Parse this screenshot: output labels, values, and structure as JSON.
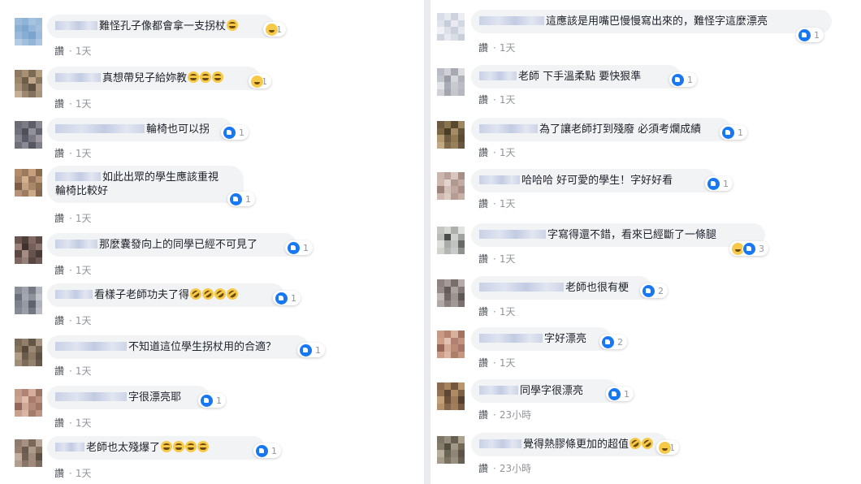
{
  "like_label": "讚",
  "left": [
    {
      "avatar": [
        "#9bbbd9",
        "#8fb3d6",
        "#a6c3de",
        "#9dbad8",
        "#8cb0d4",
        "#7fa6cf",
        "#94b6da",
        "#a3c1de",
        "#9ab8d9",
        "#88add3",
        "#7aa3cd",
        "#9cbadb",
        "#b3cce4",
        "#a2bfdd",
        "#93b5d8",
        "#aac6e1"
      ],
      "text": "難怪孔子像都會拿一支拐杖",
      "emoji": [
        "haha"
      ],
      "reacts": [
        "haha"
      ],
      "count": "1",
      "time": "1天"
    },
    {
      "avatar": [
        "#8d7a62",
        "#a89074",
        "#7b6a55",
        "#b49c7e",
        "#9a876c",
        "#6e5d49",
        "#c0a586",
        "#8a7760",
        "#a6927a",
        "#7f6d59",
        "#5f5142",
        "#b09980",
        "#c4b098",
        "#9c8870",
        "#847260",
        "#a8957d"
      ],
      "text": "真想帶兒子給妳教",
      "emoji": [
        "haha",
        "haha",
        "haha"
      ],
      "reacts": [
        "haha"
      ],
      "count": "1",
      "time": "1天"
    },
    {
      "avatar": [
        "#6b6c76",
        "#7d7a82",
        "#5c5e68",
        "#8a8790",
        "#70717b",
        "#4d4f5a",
        "#929099",
        "#63646e",
        "#85838c",
        "#5a5b66",
        "#787982",
        "#9c99a2",
        "#6f707a",
        "#8b8993",
        "#55565f",
        "#7e7f88"
      ],
      "text": "輪椅也可以拐",
      "emoji": [],
      "reacts": [
        "like"
      ],
      "count": "1",
      "time": "1天"
    },
    {
      "avatar": [
        "#b08c6a",
        "#9c7a5c",
        "#c6a07c",
        "#8a6b50",
        "#a58265",
        "#d4b08e",
        "#94735a",
        "#b99676",
        "#7c5e46",
        "#c3a182",
        "#a88768",
        "#8f7055",
        "#b5927a",
        "#9e7c62",
        "#caa888",
        "#86684f"
      ],
      "text": "如此出眾的學生應該重視\n輪椅比較好",
      "emoji": [],
      "reacts": [
        "like"
      ],
      "count": "1",
      "time": "1天"
    },
    {
      "avatar": [
        "#6a5550",
        "#4f3f3b",
        "#826a63",
        "#5c4a45",
        "#9a827a",
        "#3e312e",
        "#745e58",
        "#8c756e",
        "#5a4843",
        "#a48c83",
        "#665350",
        "#4a3b37",
        "#7e6760",
        "#94807a",
        "#574641",
        "#6f5a55"
      ],
      "text": "那麼囊發向上的同學已經不可見了",
      "emoji": [],
      "reacts": [
        "like"
      ],
      "count": "1",
      "time": "1天"
    },
    {
      "avatar": [
        "#8a8e98",
        "#9ea2ac",
        "#767a84",
        "#b2b5bd",
        "#6c707a",
        "#a3a7b0",
        "#8e929c",
        "#c0c3ca",
        "#7d818b",
        "#959aa3",
        "#5f636d",
        "#aeb1b9",
        "#868a94",
        "#9a9ea8",
        "#737781",
        "#b8bbc2"
      ],
      "text": "看樣子老師功夫了得",
      "emoji": [
        "rofl",
        "rofl",
        "rofl",
        "rofl"
      ],
      "reacts": [
        "like"
      ],
      "count": "1",
      "time": "1天"
    },
    {
      "avatar": [
        "#7a6a5a",
        "#917f6c",
        "#645647",
        "#a69380",
        "#85745f",
        "#57493b",
        "#9b8874",
        "#726251",
        "#b09d89",
        "#6a5b4b",
        "#8c7a66",
        "#5f5142",
        "#a18e7a",
        "#7d6c59",
        "#94826e",
        "#685949"
      ],
      "text": "不知道這位學生拐杖用的合適？",
      "emoji": [],
      "reacts": [
        "like"
      ],
      "count": "1",
      "time": "1天"
    },
    {
      "avatar": [
        "#c49a8a",
        "#b08474",
        "#d6ad9c",
        "#9e7464",
        "#c8a090",
        "#e0bcac",
        "#a87c6c",
        "#bb9181",
        "#92685a",
        "#d0a898",
        "#b48a7a",
        "#a07666",
        "#c9a191",
        "#dab4a4",
        "#a57b6b",
        "#be9585"
      ],
      "text": "字很漂亮耶",
      "emoji": [],
      "reacts": [
        "like"
      ],
      "count": "1",
      "time": "1天"
    },
    {
      "avatar": [
        "#8f7c6e",
        "#a69284",
        "#7a685b",
        "#b8a596",
        "#958273",
        "#6b5a4e",
        "#ad9a8b",
        "#84725f",
        "#c1ae9f",
        "#726152",
        "#9f8c7d",
        "#5e4f44",
        "#b19e8f",
        "#887667",
        "#a0897a",
        "#7d6b5d"
      ],
      "text": "老師也太殘爆了",
      "emoji": [
        "haha",
        "haha",
        "haha",
        "haha"
      ],
      "reacts": [
        "like"
      ],
      "count": "1",
      "time": "1天"
    }
  ],
  "right": [
    {
      "avatar": [
        "#d8dce6",
        "#e6e9ef",
        "#cdd2dd",
        "#eceef3",
        "#dfe2ea",
        "#c6ccd8",
        "#e9ebf1",
        "#d4d8e2",
        "#f0f1f5",
        "#dde0e8",
        "#cbd0db",
        "#e4e7ed",
        "#d1d5df",
        "#e8eaf0",
        "#d9dde6",
        "#c9cfda"
      ],
      "text": "這應該是用嘴巴慢慢寫出來的，難怪字這麼漂亮",
      "emoji": [],
      "reacts": [
        "like"
      ],
      "count": "1",
      "time": "1天"
    },
    {
      "avatar": [
        "#b9bcc3",
        "#cfd1d6",
        "#a6a9b1",
        "#dcdde1",
        "#c2c5cb",
        "#9a9da6",
        "#d5d7db",
        "#b0b3ba",
        "#e3e4e7",
        "#a9acb4",
        "#c8cad0",
        "#bbbdc4",
        "#d0d2d7",
        "#a3a6ae",
        "#c5c7cd",
        "#b5b8bf"
      ],
      "text": "老師 下手溫柔點 要快狠準",
      "emoji": [],
      "reacts": [
        "like"
      ],
      "count": "1",
      "time": "1天"
    },
    {
      "avatar": [
        "#6b5a3e",
        "#8a744f",
        "#57492f",
        "#9e8660",
        "#7a6646",
        "#4a3d26",
        "#a58c66",
        "#645238",
        "#b39a72",
        "#6e5c40",
        "#8f7852",
        "#5a4a31",
        "#c2a985",
        "#7f6a49",
        "#98805a",
        "#685640"
      ],
      "text": "為了讓老師打到殘廢 必須考爛成績",
      "emoji": [],
      "reacts": [
        "like"
      ],
      "count": "1",
      "time": "1天"
    },
    {
      "avatar": [
        "#c9b6ad",
        "#b8a198",
        "#d8c7bf",
        "#a88e85",
        "#cdb9b0",
        "#e2d4cd",
        "#b19990",
        "#c2aca3",
        "#9c8279",
        "#d3c1b9",
        "#bfa9a0",
        "#a98f86",
        "#ccb8af",
        "#dccbc4",
        "#b59d94",
        "#c6b0a7"
      ],
      "text": "哈哈哈 好可愛的學生！字好好看",
      "emoji": [],
      "reacts": [
        "like"
      ],
      "count": "1",
      "time": "1天"
    },
    {
      "avatar": [
        "#c3c6c2",
        "#d6d8d4",
        "#adb0ac",
        "#e2e3e0",
        "#b9bcb8",
        "#4b4d4a",
        "#cdd0cc",
        "#9fa29e",
        "#dcdedb",
        "#a8aba7",
        "#c0c3bf",
        "#676966",
        "#d1d3cf",
        "#b3b6b2",
        "#c7cac6",
        "#8e918d"
      ],
      "text": "字寫得還不錯，看來已經斷了一條腿",
      "emoji": [],
      "reacts": [
        "haha",
        "like"
      ],
      "count": "3",
      "time": "1天"
    },
    {
      "avatar": [
        "#8e8380",
        "#a59a97",
        "#786e6b",
        "#b5acaa",
        "#968b88",
        "#655c5a",
        "#aca3a1",
        "#837976",
        "#c0b8b6",
        "#716866",
        "#9d9390",
        "#5f5755",
        "#b1a8a6",
        "#8a807d",
        "#a29896",
        "#7a716e"
      ],
      "text": "老師也很有梗",
      "emoji": [],
      "reacts": [
        "like"
      ],
      "count": "2",
      "time": "1天"
    },
    {
      "avatar": [
        "#c89a86",
        "#b5836f",
        "#d9b09d",
        "#a4735f",
        "#cc9f8b",
        "#e3c0af",
        "#b08070",
        "#c29480",
        "#96685a",
        "#d4a995",
        "#bb8b77",
        "#a67766",
        "#ca9d89",
        "#dcb6a4",
        "#ae7e6c",
        "#c5977f"
      ],
      "text": "字好漂亮",
      "emoji": [],
      "reacts": [
        "like"
      ],
      "count": "2",
      "time": "1天"
    },
    {
      "avatar": [
        "#8b6a4e",
        "#a6845f",
        "#735640",
        "#b8966f",
        "#937253",
        "#5f4633",
        "#ad8b65",
        "#7d5f46",
        "#c2a07a",
        "#6b4f39",
        "#9c7a58",
        "#553f2e",
        "#b3916b",
        "#86664a",
        "#a07e5c",
        "#77593f"
      ],
      "text": "同學字很漂亮",
      "emoji": [],
      "reacts": [
        "like"
      ],
      "count": "1",
      "time": "23小時"
    },
    {
      "avatar": [
        "#7d7566",
        "#968d7c",
        "#675f52",
        "#aaa18f",
        "#857c6b",
        "#544d42",
        "#a09786",
        "#716858",
        "#b6ad9b",
        "#6b6354",
        "#8f8675",
        "#5c5448",
        "#a59c8a",
        "#7a7162",
        "#988f7e",
        "#675f51"
      ],
      "text": "覺得熱膠條更加的超值",
      "emoji": [
        "rofl",
        "rofl"
      ],
      "reacts": [
        "haha"
      ],
      "count": "1",
      "time": "23小時"
    }
  ]
}
